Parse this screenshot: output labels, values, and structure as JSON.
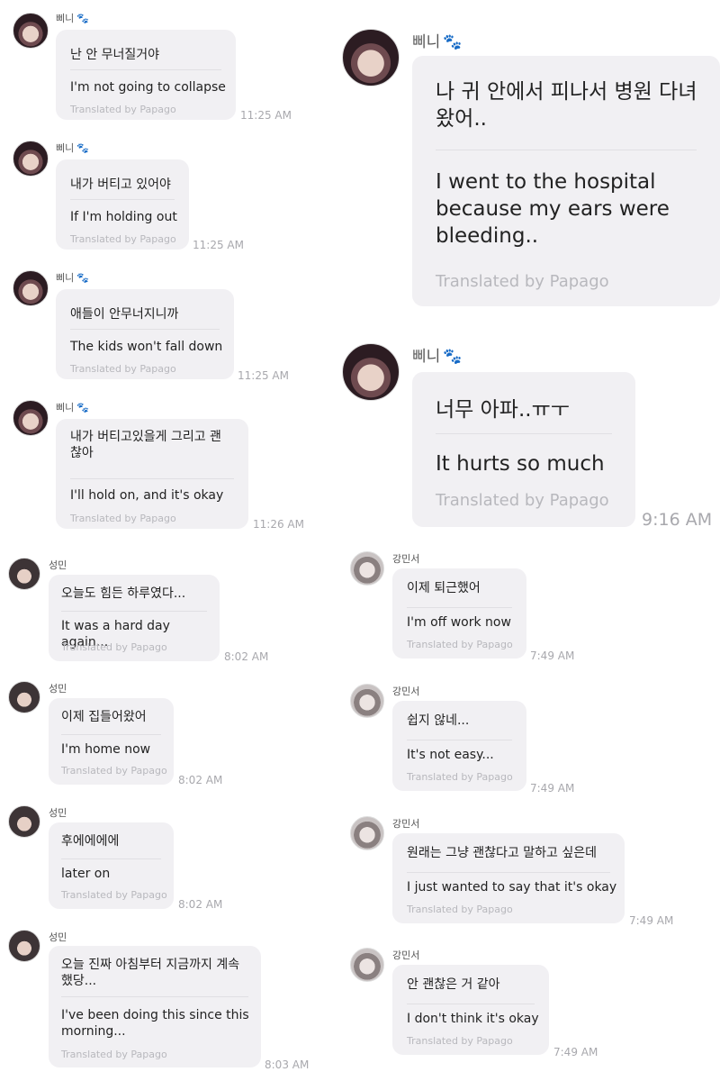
{
  "translated_label": "Translated by Papago",
  "left_top": [
    {
      "sender": "삐니",
      "ko": "난 안 무너질거야",
      "en": "I'm not going to collapse",
      "time": "11:25 AM"
    },
    {
      "sender": "삐니",
      "ko": "내가 버티고 있어야",
      "en": "If I'm holding out",
      "time": "11:25 AM"
    },
    {
      "sender": "삐니",
      "ko": "애들이 안무너지니까",
      "en": "The kids won't fall down",
      "time": "11:25 AM"
    },
    {
      "sender": "삐니",
      "ko": "내가 버티고있을게 그리고 괜찮아",
      "en": "I'll hold on, and it's okay",
      "time": "11:26 AM"
    }
  ],
  "right_top": [
    {
      "sender": "삐니",
      "ko": "나 귀 안에서 피나서 병원 다녀왔어..",
      "en": "I went to the hospital because my ears were bleeding..",
      "time": ""
    },
    {
      "sender": "삐니",
      "ko": "너무 아파..ㅠㅜ",
      "en": "It hurts so much",
      "time": "9:16 AM"
    }
  ],
  "left_bottom": [
    {
      "sender": "성민",
      "ko": "오늘도 힘든 하루였다...",
      "en": "It was a hard day again...",
      "time": "8:02 AM"
    },
    {
      "sender": "성민",
      "ko": "이제 집들어왔어",
      "en": "I'm home now",
      "time": "8:02 AM"
    },
    {
      "sender": "성민",
      "ko": "후에에에에",
      "en": "later on",
      "time": "8:02 AM"
    },
    {
      "sender": "성민",
      "ko": "오늘 진짜 아침부터 지금까지 계속 했당...",
      "en": "I've been doing this since this morning...",
      "time": "8:03 AM"
    }
  ],
  "right_bottom": [
    {
      "sender": "강민서",
      "ko": "이제 퇴근했어",
      "en": "I'm off work now",
      "time": "7:49 AM"
    },
    {
      "sender": "강민서",
      "ko": "쉽지 않네...",
      "en": "It's not easy...",
      "time": "7:49 AM"
    },
    {
      "sender": "강민서",
      "ko": "원래는 그냥 괜찮다고 말하고 싶은데",
      "en": "I just wanted to say that it's okay",
      "time": "7:49 AM"
    },
    {
      "sender": "강민서",
      "ko": "안 괜찮은 거 같아",
      "en": "I don't think it's okay",
      "time": "7:49 AM"
    }
  ],
  "icons": {
    "paw": "paw-icon",
    "avatar": "profile-avatar"
  },
  "colors": {
    "bubble": "#f1f0f3",
    "muted_text": "#b8b8bd",
    "time_text": "#a8a8ad"
  }
}
